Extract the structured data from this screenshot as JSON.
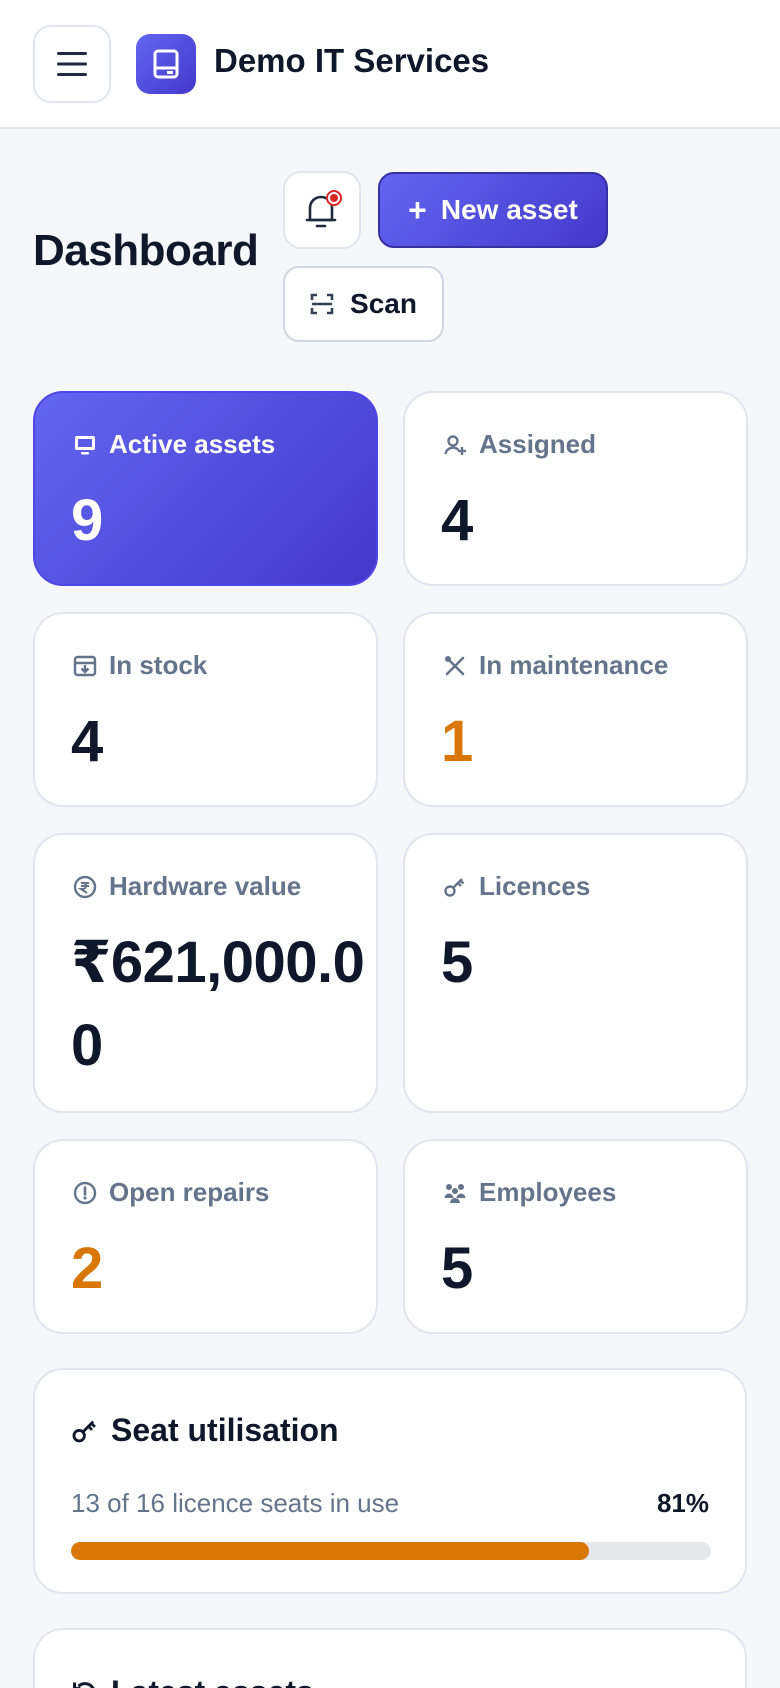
{
  "header": {
    "brand_name": "Demo IT Services"
  },
  "page": {
    "title": "Dashboard"
  },
  "actions": {
    "new_asset": "New asset",
    "scan": "Scan",
    "notification_dot": true
  },
  "stats": [
    {
      "label": "Active assets",
      "value": "9",
      "icon": "monitor-icon",
      "style": "primary"
    },
    {
      "label": "Assigned",
      "value": "4",
      "icon": "user-plus-icon",
      "style": "normal"
    },
    {
      "label": "In stock",
      "value": "4",
      "icon": "archive-box-icon",
      "style": "normal"
    },
    {
      "label": "In maintenance",
      "value": "1",
      "icon": "tools-icon",
      "style": "warn"
    },
    {
      "label": "Hardware value",
      "value": "₹621,000.00",
      "icon": "rupee-circle-icon",
      "style": "normal"
    },
    {
      "label": "Licences",
      "value": "5",
      "icon": "key-icon",
      "style": "normal"
    },
    {
      "label": "Open repairs",
      "value": "2",
      "icon": "alert-circle-icon",
      "style": "warn"
    },
    {
      "label": "Employees",
      "value": "5",
      "icon": "people-icon",
      "style": "normal"
    }
  ],
  "seat_utilisation": {
    "title": "Seat utilisation",
    "summary": "13 of 16 licence seats in use",
    "percent_label": "81%",
    "fraction": 0.81
  },
  "latest_assets": {
    "title": "Latest assets"
  },
  "colors": {
    "accent": "#4f46e5",
    "warning": "#d97706",
    "muted": "#64748b",
    "text": "#0f172a"
  }
}
